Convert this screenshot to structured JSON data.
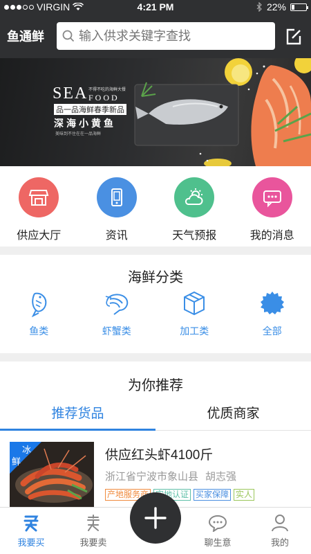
{
  "status_bar": {
    "carrier": "VIRGIN",
    "time": "4:21 PM",
    "battery_percent": "22%",
    "battery_level": 0.22
  },
  "header": {
    "app_title": "鱼通鲜",
    "search_placeholder": "输入供求关键字查找"
  },
  "banner": {
    "brand_top": "SEA",
    "brand_bottom": "FOOD",
    "small_caption": "不得不吃的海鲜大餐",
    "subtitle": "品一品海鲜春季新品",
    "headline": "深海小黄鱼",
    "tagline": "美味到不住在在一品海鲜"
  },
  "quick_actions": [
    {
      "label": "供应大厅",
      "icon": "store-icon",
      "color": "#ee6764"
    },
    {
      "label": "资讯",
      "icon": "phone-icon",
      "color": "#4a90e2"
    },
    {
      "label": "天气预报",
      "icon": "weather-icon",
      "color": "#4fc08d"
    },
    {
      "label": "我的消息",
      "icon": "message-icon",
      "color": "#e9559c"
    }
  ],
  "categories": {
    "title": "海鲜分类",
    "items": [
      {
        "label": "鱼类",
        "icon": "fish-icon"
      },
      {
        "label": "虾蟹类",
        "icon": "shrimp-icon"
      },
      {
        "label": "加工类",
        "icon": "box-icon"
      },
      {
        "label": "全部",
        "icon": "all-icon"
      }
    ]
  },
  "recommend": {
    "title": "为你推荐",
    "tabs": [
      "推荐货品",
      "优质商家"
    ],
    "active_tab": 0,
    "product": {
      "ribbon_line1": "冰",
      "ribbon_line2": "鲜",
      "title": "供应红头虾4100斤",
      "location": "浙江省宁波市象山县",
      "seller": "胡志强",
      "tags": [
        {
          "label": "产地服务商",
          "color": "#f08a3c"
        },
        {
          "label": "实地认证",
          "color": "#5fbfa8"
        },
        {
          "label": "买家保障",
          "color": "#4a8fe0"
        },
        {
          "label": "实人",
          "color": "#9ac65a"
        }
      ]
    }
  },
  "bottom_nav": [
    {
      "label": "我要买",
      "icon": "buy-icon",
      "active": true
    },
    {
      "label": "我要卖",
      "icon": "sell-icon",
      "active": false
    },
    {
      "label": "聊生意",
      "icon": "chat-icon",
      "active": false
    },
    {
      "label": "我的",
      "icon": "profile-icon",
      "active": false
    }
  ],
  "colors": {
    "header_bg": "#2f3032",
    "accent": "#2f83e0"
  }
}
